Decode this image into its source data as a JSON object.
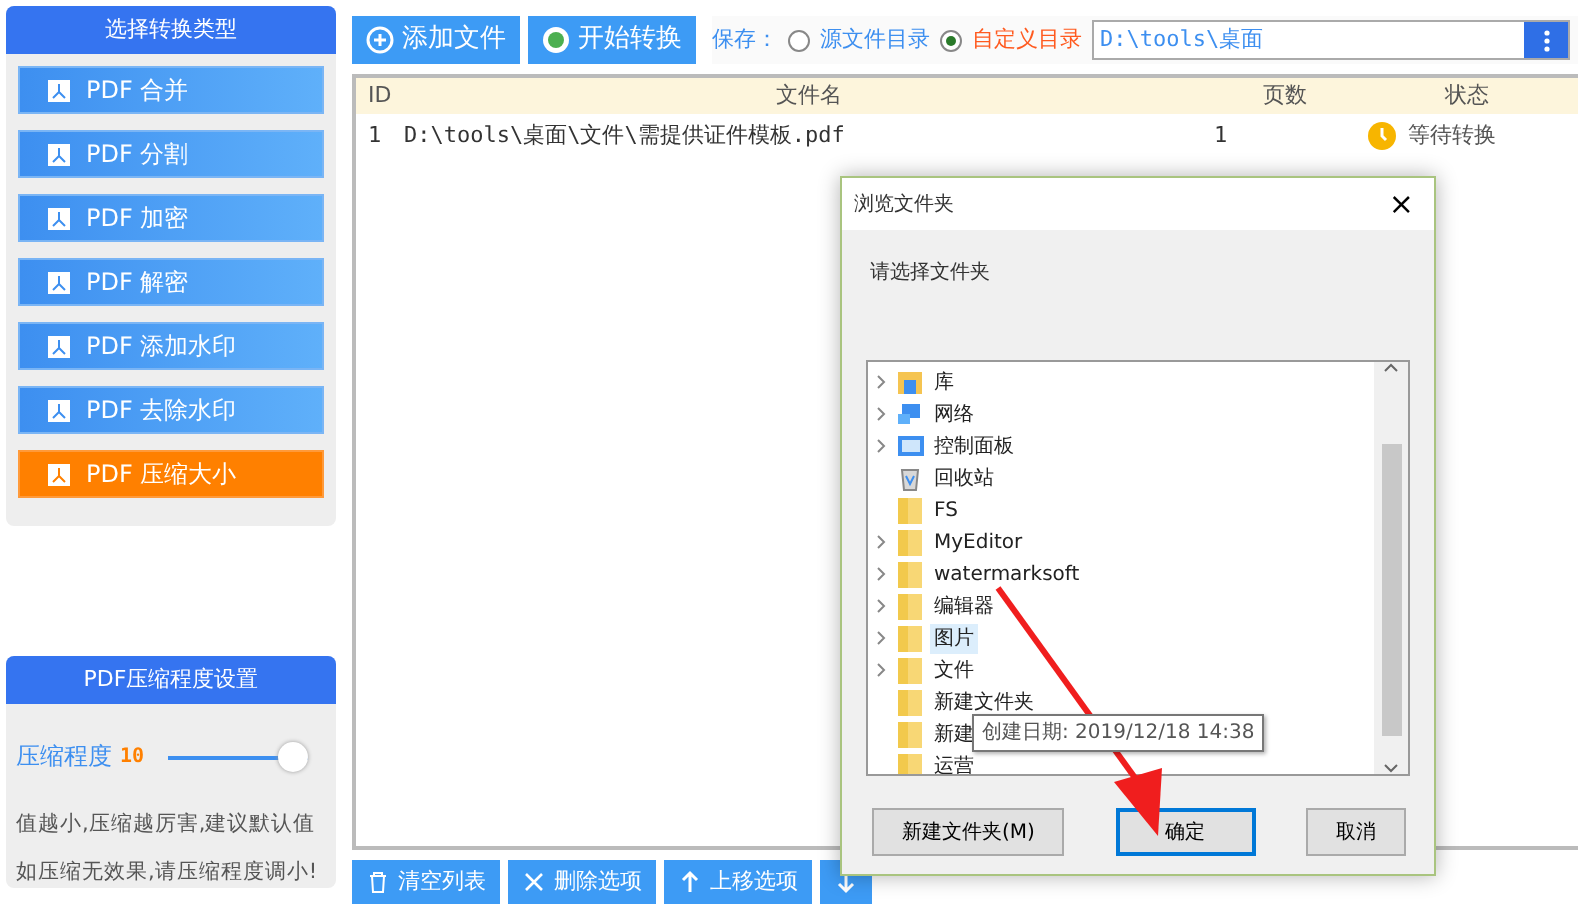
{
  "sidebar": {
    "title": "选择转换类型",
    "items": [
      {
        "label": "PDF 合并",
        "selected": false
      },
      {
        "label": "PDF 分割",
        "selected": false
      },
      {
        "label": "PDF 加密",
        "selected": false
      },
      {
        "label": "PDF 解密",
        "selected": false
      },
      {
        "label": "PDF 添加水印",
        "selected": false
      },
      {
        "label": "PDF 去除水印",
        "selected": false
      },
      {
        "label": "PDF 压缩大小",
        "selected": true
      }
    ]
  },
  "compression": {
    "title": "PDF压缩程度设置",
    "label": "压缩程度",
    "value": "10",
    "level": 1,
    "notes": [
      "值越小,压缩越厉害,建议默认值",
      "如压缩无效果,请压缩程度调小!"
    ]
  },
  "toolbar": {
    "buttons": [
      {
        "label": "添加文件",
        "kind": "add"
      },
      {
        "label": "开始转换",
        "kind": "start"
      }
    ],
    "save_label": "保存：",
    "options": [
      {
        "label": "源文件目录",
        "selected": false
      },
      {
        "label": "自定义目录",
        "selected": true
      }
    ],
    "path": "D:\\tools\\桌面"
  },
  "table": {
    "columns": [
      "ID",
      "文件名",
      "页数",
      "状态"
    ],
    "rows": [
      {
        "id": "1",
        "file": "D:\\tools\\桌面\\文件\\需提供证件模板.pdf",
        "pages": "1",
        "status": "等待转换"
      }
    ]
  },
  "bottom_buttons": [
    {
      "label": "清空列表",
      "kind": "clear"
    },
    {
      "label": "删除选项",
      "kind": "delete"
    },
    {
      "label": "上移选项",
      "kind": "up"
    },
    {
      "kind": "down"
    }
  ],
  "dialog": {
    "title": "浏览文件夹",
    "close": "×",
    "prompt": "请选择文件夹",
    "tree": [
      {
        "label": "库",
        "kind": "library",
        "expandable": true,
        "selected": false
      },
      {
        "label": "网络",
        "kind": "network",
        "expandable": true,
        "selected": false
      },
      {
        "label": "控制面板",
        "kind": "control",
        "expandable": true,
        "selected": false
      },
      {
        "label": "回收站",
        "kind": "recycle",
        "expandable": false,
        "selected": false
      },
      {
        "label": "FS",
        "kind": "folder",
        "expandable": false,
        "selected": false
      },
      {
        "label": "MyEditor",
        "kind": "folder",
        "expandable": true,
        "selected": false
      },
      {
        "label": "watermarksoft",
        "kind": "folder",
        "expandable": true,
        "selected": false
      },
      {
        "label": "编辑器",
        "kind": "folder",
        "expandable": true,
        "selected": false
      },
      {
        "label": "图片",
        "kind": "folder",
        "expandable": true,
        "selected": true
      },
      {
        "label": "文件",
        "kind": "folder",
        "expandable": true,
        "selected": false
      },
      {
        "label": "新建文件夹",
        "kind": "folder",
        "expandable": false,
        "selected": false
      },
      {
        "label": "新建",
        "kind": "folder",
        "expandable": false,
        "selected": false
      },
      {
        "label": "运营",
        "kind": "folder",
        "expandable": false,
        "selected": false
      }
    ],
    "tooltip": "创建日期: 2019/12/18 14:38",
    "buttons": [
      {
        "label": "新建文件夹(M)",
        "selected": false
      },
      {
        "label": "确定",
        "selected": true
      },
      {
        "label": "取消",
        "selected": false
      }
    ]
  }
}
